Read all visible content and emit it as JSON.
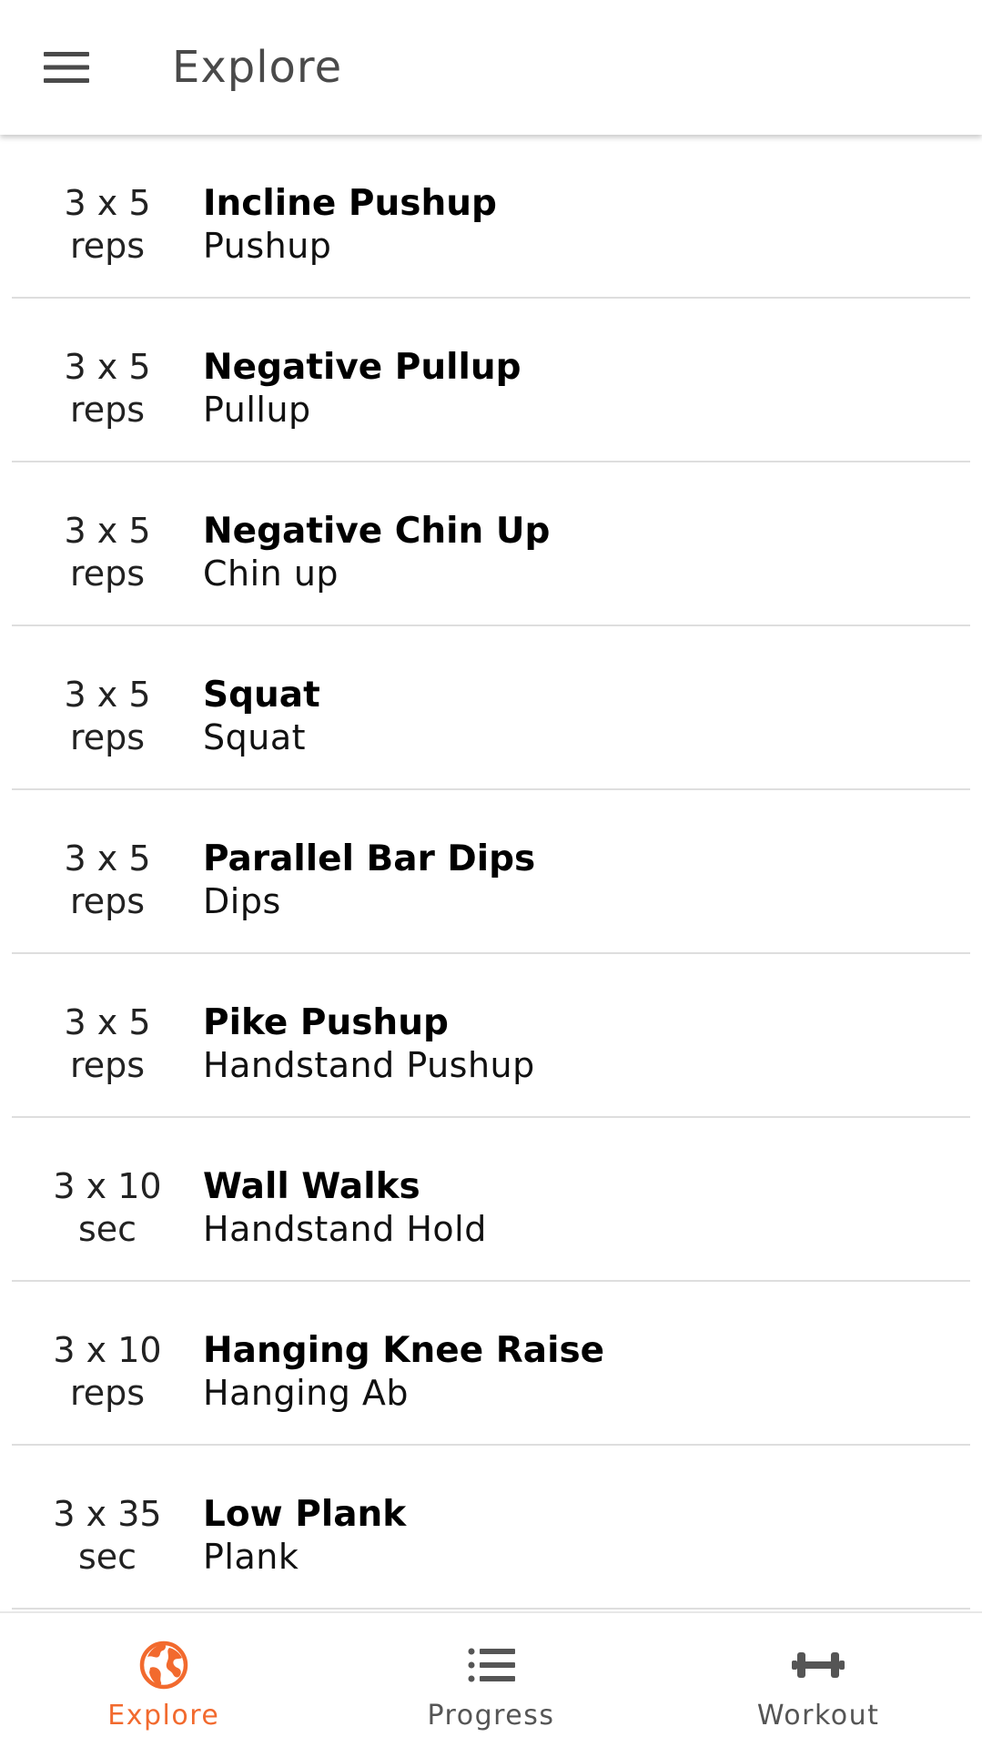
{
  "appbar": {
    "title": "Explore",
    "menu_icon": "hamburger-menu-icon"
  },
  "exercises": [
    {
      "dose_line1": "3 x 5",
      "dose_line2": "reps",
      "name": "Incline Pushup",
      "category": "Pushup"
    },
    {
      "dose_line1": "3 x 5",
      "dose_line2": "reps",
      "name": "Negative Pullup",
      "category": "Pullup"
    },
    {
      "dose_line1": "3 x 5",
      "dose_line2": "reps",
      "name": "Negative Chin Up",
      "category": "Chin up"
    },
    {
      "dose_line1": "3 x 5",
      "dose_line2": "reps",
      "name": "Squat",
      "category": "Squat"
    },
    {
      "dose_line1": "3 x 5",
      "dose_line2": "reps",
      "name": "Parallel Bar Dips",
      "category": "Dips"
    },
    {
      "dose_line1": "3 x 5",
      "dose_line2": "reps",
      "name": "Pike Pushup",
      "category": "Handstand Pushup"
    },
    {
      "dose_line1": "3 x 10",
      "dose_line2": "sec",
      "name": "Wall Walks",
      "category": "Handstand Hold"
    },
    {
      "dose_line1": "3 x 10",
      "dose_line2": "reps",
      "name": "Hanging Knee Raise",
      "category": "Hanging Ab"
    },
    {
      "dose_line1": "3 x 35",
      "dose_line2": "sec",
      "name": "Low Plank",
      "category": "Plank"
    }
  ],
  "bottom_nav": {
    "items": [
      {
        "label": "Explore",
        "icon": "globe-icon",
        "active": true
      },
      {
        "label": "Progress",
        "icon": "list-icon",
        "active": false
      },
      {
        "label": "Workout",
        "icon": "dumbbell-icon",
        "active": false
      }
    ]
  },
  "colors": {
    "accent": "#f26a2e",
    "inactive": "#555555",
    "divider": "#dedede"
  }
}
